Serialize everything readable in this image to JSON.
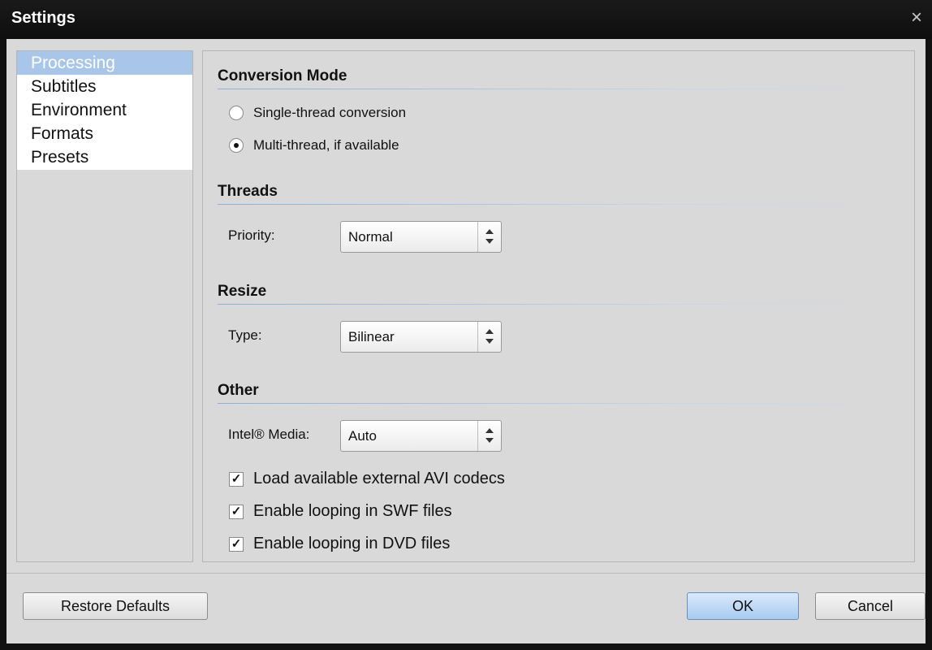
{
  "window": {
    "title": "Settings"
  },
  "sidebar": {
    "items": [
      {
        "label": "Processing",
        "selected": true
      },
      {
        "label": "Subtitles"
      },
      {
        "label": "Environment"
      },
      {
        "label": "Formats"
      },
      {
        "label": "Presets"
      }
    ]
  },
  "conversion_mode": {
    "title": "Conversion Mode",
    "options": [
      {
        "label": "Single-thread conversion",
        "checked": false
      },
      {
        "label": "Multi-thread, if available",
        "checked": true
      }
    ]
  },
  "threads": {
    "title": "Threads",
    "priority_label": "Priority:",
    "priority_value": "Normal"
  },
  "resize": {
    "title": "Resize",
    "type_label": "Type:",
    "type_value": "Bilinear"
  },
  "other": {
    "title": "Other",
    "intel_label": "Intel® Media:",
    "intel_value": "Auto",
    "checks": [
      {
        "label": "Load available external AVI codecs",
        "checked": true,
        "mark": "✓"
      },
      {
        "label": "Enable looping in SWF files",
        "checked": true,
        "mark": "✓"
      },
      {
        "label": "Enable looping in DVD files",
        "checked": true,
        "mark": "✓"
      }
    ]
  },
  "buttons": {
    "restore": "Restore Defaults",
    "ok": "OK",
    "cancel": "Cancel"
  },
  "icons": {
    "close": "×"
  }
}
